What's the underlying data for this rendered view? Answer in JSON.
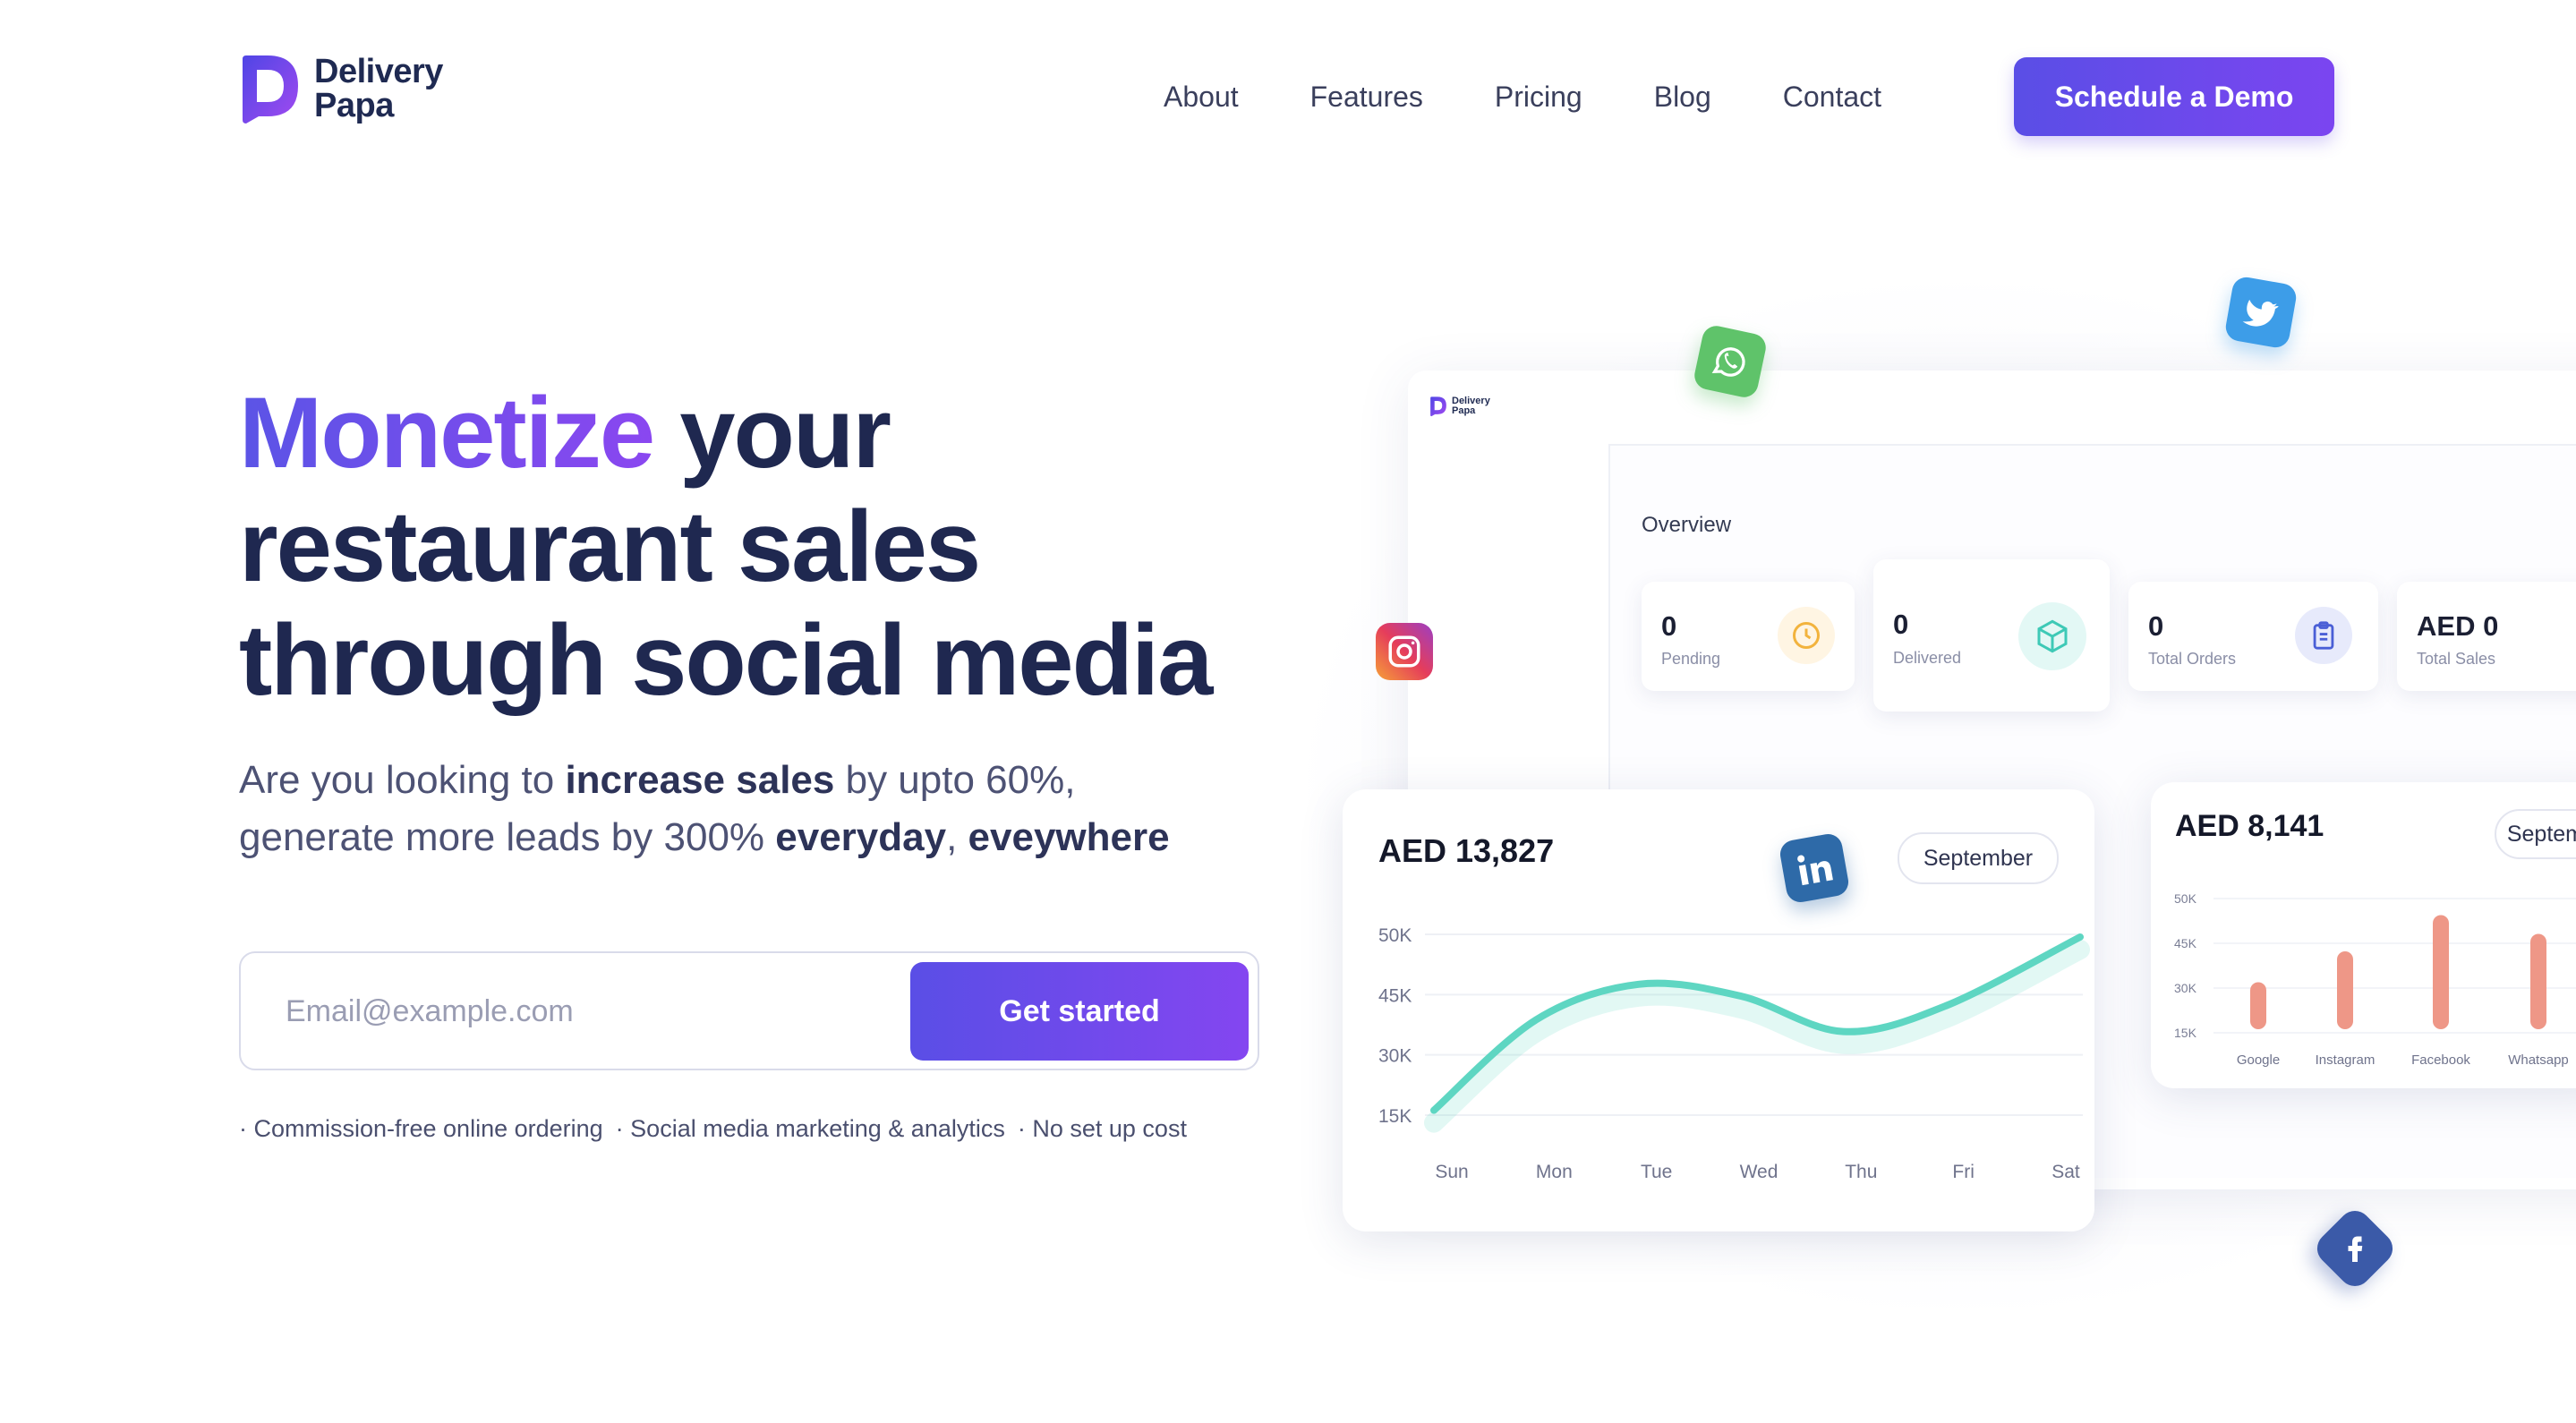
{
  "brand": {
    "line1": "Delivery",
    "line2": "Papa",
    "colors": {
      "primary": "#5a4ee6",
      "accent": "#8a47f0",
      "navy": "#1f2850"
    }
  },
  "nav": {
    "links": [
      "About",
      "Features",
      "Pricing",
      "Blog",
      "Contact"
    ],
    "cta": "Schedule a Demo"
  },
  "hero": {
    "title_accent": "Monetize",
    "title_rest_1": " your",
    "title_line_2": "restaurant sales",
    "title_line_3": "through social media",
    "sub_1a": "Are you looking to ",
    "sub_1b": "increase sales",
    "sub_1c": " by upto 60%,",
    "sub_2a": "generate more leads by 300% ",
    "sub_2b": "everyday",
    "sub_2c": ", ",
    "sub_2d": "eveywhere",
    "email_placeholder": "Email@example.com",
    "submit_label": "Get started",
    "features": [
      "Commission-free online ordering",
      "Social media marketing & analytics",
      "No set up cost"
    ]
  },
  "dashboard": {
    "logo_line1": "Delivery",
    "logo_line2": "Papa",
    "overview_label": "Overview",
    "stats": [
      {
        "value": "0",
        "label": "Pending",
        "icon": "clock-icon",
        "color": "#f2b33d",
        "bg": "#fff5e3"
      },
      {
        "value": "0",
        "label": "Delivered",
        "icon": "box-icon",
        "color": "#3ec9b6",
        "bg": "#e3f8f5"
      },
      {
        "value": "0",
        "label": "Total Orders",
        "icon": "clipboard-icon",
        "color": "#4a5fd6",
        "bg": "#e7eafb"
      },
      {
        "value": "AED 0",
        "label": "Total Sales"
      }
    ],
    "sales_card": {
      "amount": "AED 13,827",
      "month": "September"
    },
    "channel_card": {
      "amount": "AED 8,141",
      "month": "September"
    }
  },
  "social_icons": [
    "whatsapp-icon",
    "twitter-icon",
    "instagram-icon",
    "linkedin-icon",
    "facebook-icon"
  ],
  "chart_data": [
    {
      "type": "line",
      "categories": [
        "Sun",
        "Mon",
        "Tue",
        "Wed",
        "Thu",
        "Fri",
        "Sat"
      ],
      "yticks": [
        "50K",
        "45K",
        "30K",
        "15K"
      ],
      "series": [
        {
          "values": [
            0.07,
            0.53,
            0.71,
            0.65,
            0.47,
            0.6,
            0.95
          ],
          "color": "#5ed6c2"
        }
      ],
      "note": "y axis labels are non-linear; values are relative heights on the printed scale",
      "grid": true
    },
    {
      "type": "bar",
      "categories": [
        "Google",
        "Instagram",
        "Facebook",
        "Whatsapp"
      ],
      "yticks": [
        "50K",
        "45K",
        "30K",
        "15K"
      ],
      "values": [
        0.35,
        0.58,
        0.85,
        0.71
      ],
      "color": "#ee9787"
    }
  ]
}
